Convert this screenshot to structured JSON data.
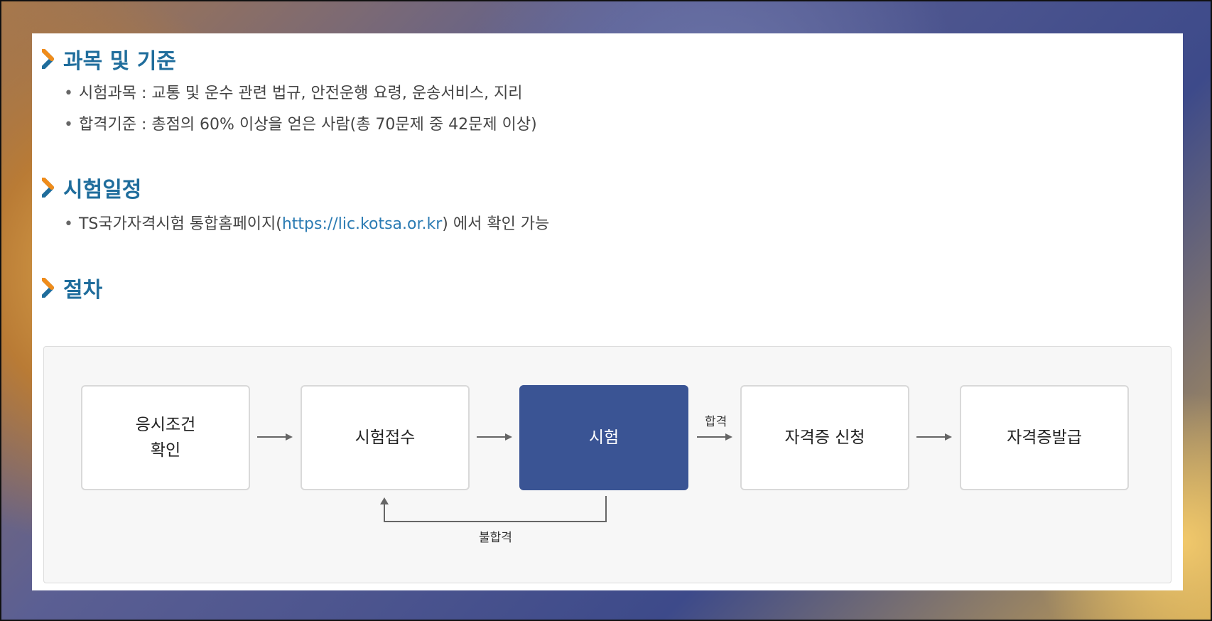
{
  "sections": {
    "subject": {
      "title": "과목 및 기준",
      "items": [
        "시험과목 : 교통 및 운수 관련 법규, 안전운행 요령, 운송서비스, 지리",
        "합격기준 : 총점의 60% 이상을 얻은 사람(총 70문제 중 42문제 이상)"
      ]
    },
    "schedule": {
      "title": "시험일정",
      "item_prefix": "TS국가자격시험 통합홈페이지(",
      "item_link": "https://lic.kotsa.or.kr",
      "item_suffix": ") 에서 확인 가능"
    },
    "procedure": {
      "title": "절차",
      "steps": [
        {
          "line1": "응시조건",
          "line2": "확인"
        },
        {
          "line1": "시험접수",
          "line2": ""
        },
        {
          "line1": "시험",
          "line2": ""
        },
        {
          "line1": "자격증 신청",
          "line2": ""
        },
        {
          "line1": "자격증발급",
          "line2": ""
        }
      ],
      "pass_label": "합격",
      "fail_label": "불합격"
    }
  },
  "colors": {
    "title": "#1f6d9c",
    "accent_chevron": "#f08c1a",
    "active_step": "#3a5494",
    "link": "#2b7bb3"
  },
  "icons": {
    "section_marker": "chevron-right-icon",
    "flow": "arrow-right-icon"
  }
}
